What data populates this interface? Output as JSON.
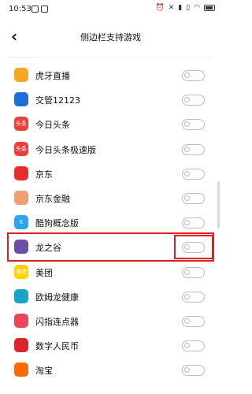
{
  "status_bar": {
    "time": "10:53",
    "icons": [
      "notification-icon",
      "notification-icon",
      "alarm-icon",
      "mute-icon",
      "sim-icon",
      "vibrate-icon",
      "wifi-icon",
      "battery-icon"
    ]
  },
  "header": {
    "title": "侧边栏支持游戏"
  },
  "apps": [
    {
      "label": "虎牙直播",
      "icon": "huya-icon",
      "color": "#f5a623",
      "badge": "",
      "enabled": false
    },
    {
      "label": "交管12123",
      "icon": "jiaoguan-icon",
      "color": "#1e6fd9",
      "badge": "",
      "enabled": false
    },
    {
      "label": "今日头条",
      "icon": "toutiao-icon",
      "color": "#e8413a",
      "badge": "头条",
      "enabled": false
    },
    {
      "label": "今日头条极速版",
      "icon": "toutiao-lite-icon",
      "color": "#e8413a",
      "badge": "头条",
      "enabled": false
    },
    {
      "label": "京东",
      "icon": "jd-icon",
      "color": "#e52e2e",
      "badge": "",
      "enabled": false
    },
    {
      "label": "京东金融",
      "icon": "jd-finance-icon",
      "color": "#f0a070",
      "badge": "",
      "enabled": false
    },
    {
      "label": "酷狗概念版",
      "icon": "kugou-icon",
      "color": "#2aa6f0",
      "badge": "K",
      "enabled": false
    },
    {
      "label": "龙之谷",
      "icon": "dragon-nest-icon",
      "color": "#6b4fa5",
      "badge": "",
      "enabled": false
    },
    {
      "label": "美团",
      "icon": "meituan-icon",
      "color": "#ffd100",
      "badge": "美团",
      "enabled": false
    },
    {
      "label": "欧姆龙健康",
      "icon": "omron-icon",
      "color": "#1aa3c6",
      "badge": "",
      "enabled": false
    },
    {
      "label": "闪指连点器",
      "icon": "clicker-icon",
      "color": "#e9475a",
      "badge": "",
      "enabled": false
    },
    {
      "label": "数字人民币",
      "icon": "ecny-icon",
      "color": "#d8262c",
      "badge": "",
      "enabled": false
    },
    {
      "label": "淘宝",
      "icon": "taobao-icon",
      "color": "#ff6a00",
      "badge": "",
      "enabled": false
    }
  ]
}
